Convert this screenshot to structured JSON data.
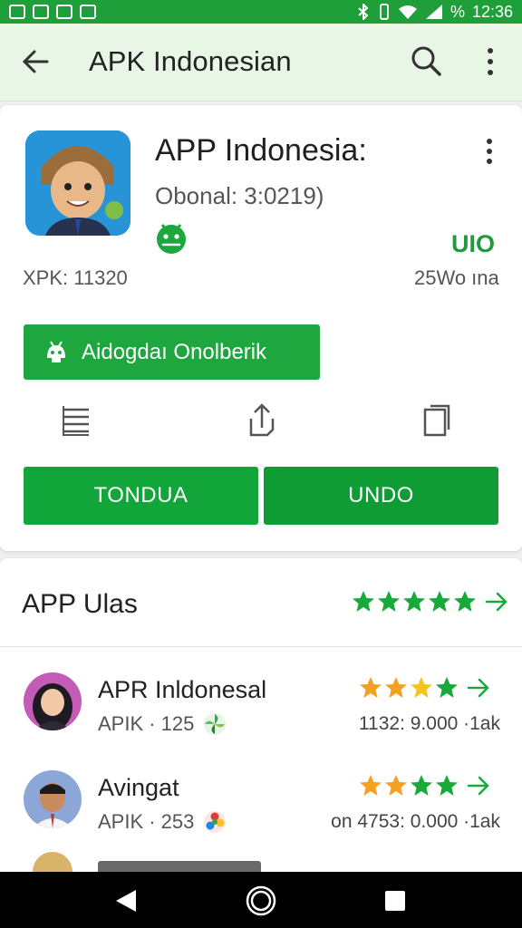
{
  "status_bar": {
    "time": "12:36",
    "battery": "%",
    "left_icons": [
      "gallery-icon",
      "b-icon",
      "b-icon",
      "image-icon"
    ],
    "right_icons": [
      "bluetooth-icon",
      "vibrate-icon",
      "wifi-icon",
      "signal-icon"
    ]
  },
  "app_bar": {
    "title": "APK Indonesian",
    "back_icon": "arrow-left-icon",
    "search_icon": "search-icon",
    "menu_icon": "more-vert-icon"
  },
  "app_card": {
    "name": "APP Indonesia:",
    "meta": "Obonal: 3:0219)",
    "badge_icon": "android-icon",
    "tag": "UIO",
    "size_label": "XPK: 11320",
    "downloads": "25Wo ına",
    "install_button": {
      "label": "Aidogdaı Onolberik",
      "icon": "android-icon"
    },
    "action_icons": [
      "list-icon",
      "share-icon",
      "copy-icon"
    ],
    "buttons": [
      {
        "label": "TONDUA"
      },
      {
        "label": "UNDO"
      }
    ]
  },
  "reviews": {
    "title": "APP Ulas",
    "rating_stars": 5,
    "items": [
      {
        "name": "APR Inldonesal",
        "sub": "APIK · 125",
        "count": "1132: 9.000 ·1ak",
        "stars": 4,
        "badge": "pinwheel-icon"
      },
      {
        "name": "Avingat",
        "sub": "APIK · 253",
        "count": "on 4753: 0.000 ·1ak",
        "stars": 4,
        "badge": "flower-icon"
      }
    ]
  },
  "nav_bar": {
    "items": [
      "nav-back-icon",
      "nav-home-icon",
      "nav-recents-icon"
    ]
  },
  "colors": {
    "accent": "#1ea73f",
    "status_bar": "#1f9f3a",
    "app_bar_bg": "#e8f6e6",
    "star_green": "#18a93b",
    "star_orange": "#f5a01f"
  }
}
